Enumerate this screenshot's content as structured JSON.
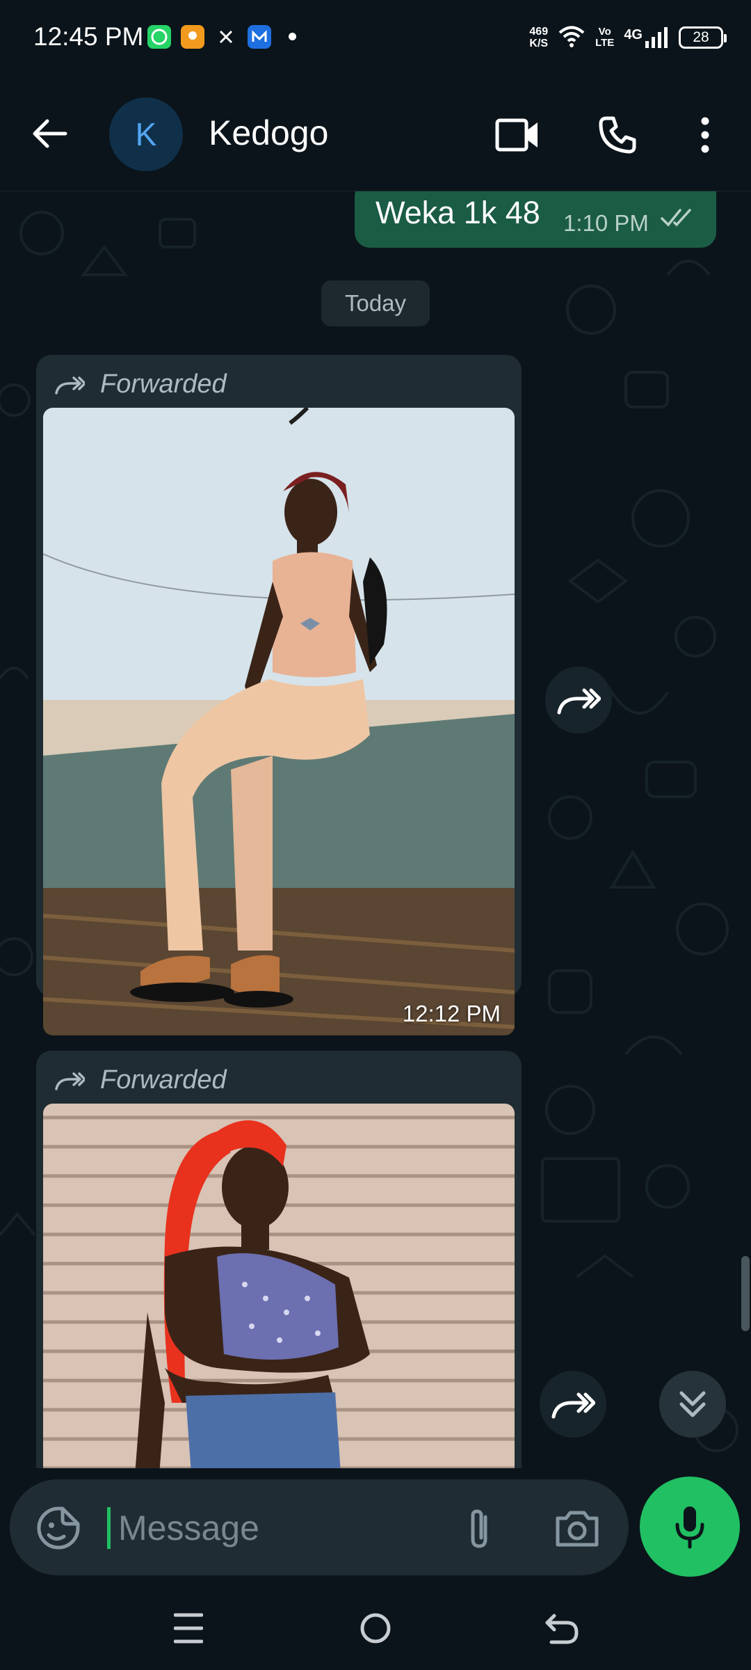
{
  "status_bar": {
    "time": "12:45 PM",
    "net_speed_value": "469",
    "net_speed_unit": "K/S",
    "volte_top": "Vo",
    "volte_bottom": "LTE",
    "network": "4G",
    "battery": "28",
    "notification_icons": [
      "whatsapp-icon",
      "orange-app-icon",
      "x-icon",
      "blue-app-icon"
    ]
  },
  "header": {
    "avatar_initial": "K",
    "contact_name": "Kedogo",
    "icons": [
      "back-arrow-icon",
      "video-call-icon",
      "voice-call-icon",
      "more-options-icon"
    ]
  },
  "chat": {
    "outgoing": {
      "text": "Weka 1k 48",
      "time": "1:10 PM",
      "status_icon": "double-check-icon"
    },
    "date_separator": "Today",
    "messages": [
      {
        "forwarded_label": "Forwarded",
        "time": "12:12 PM",
        "type": "image"
      },
      {
        "forwarded_label": "Forwarded",
        "type": "image"
      }
    ]
  },
  "composer": {
    "placeholder": "Message",
    "icons": [
      "sticker-icon",
      "attach-icon",
      "camera-icon",
      "mic-icon"
    ]
  },
  "nav_bar": {
    "icons": [
      "menu-icon",
      "home-icon",
      "back-icon"
    ]
  },
  "colors": {
    "background": "#0b141a",
    "outgoing_bubble": "#1b5c45",
    "incoming_bubble": "#1f2c33",
    "accent_green": "#21c063"
  }
}
